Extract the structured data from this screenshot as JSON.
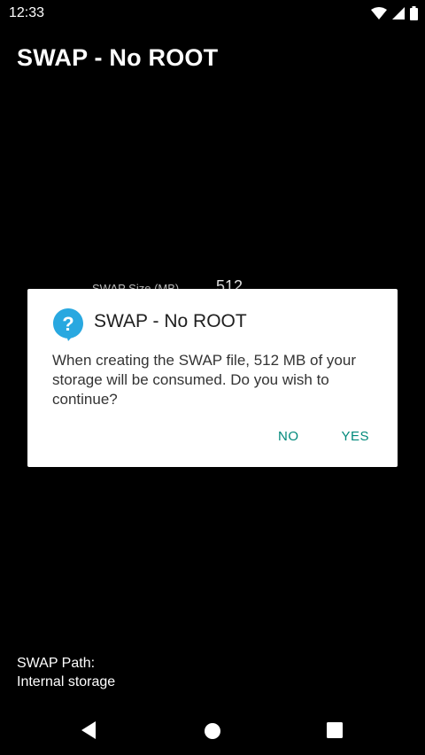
{
  "status_bar": {
    "time": "12:33",
    "icons": [
      "wifi-icon",
      "signal-icon",
      "battery-icon"
    ]
  },
  "app": {
    "title": "SWAP - No ROOT"
  },
  "background": {
    "size_label": "SWAP Size (MB)",
    "size_value": "512"
  },
  "dialog": {
    "icon": "question-icon",
    "title": "SWAP - No ROOT",
    "message": "When creating the SWAP file, 512 MB of your storage will be consumed. Do you wish to continue?",
    "no_label": "NO",
    "yes_label": "YES",
    "accent_color": "#00897b",
    "icon_color": "#29a8e0"
  },
  "bottom_info": {
    "path_label": "SWAP Path:",
    "path_value": "Internal storage"
  },
  "nav_bar": {
    "buttons": [
      "back-icon",
      "home-icon",
      "recents-icon"
    ]
  }
}
